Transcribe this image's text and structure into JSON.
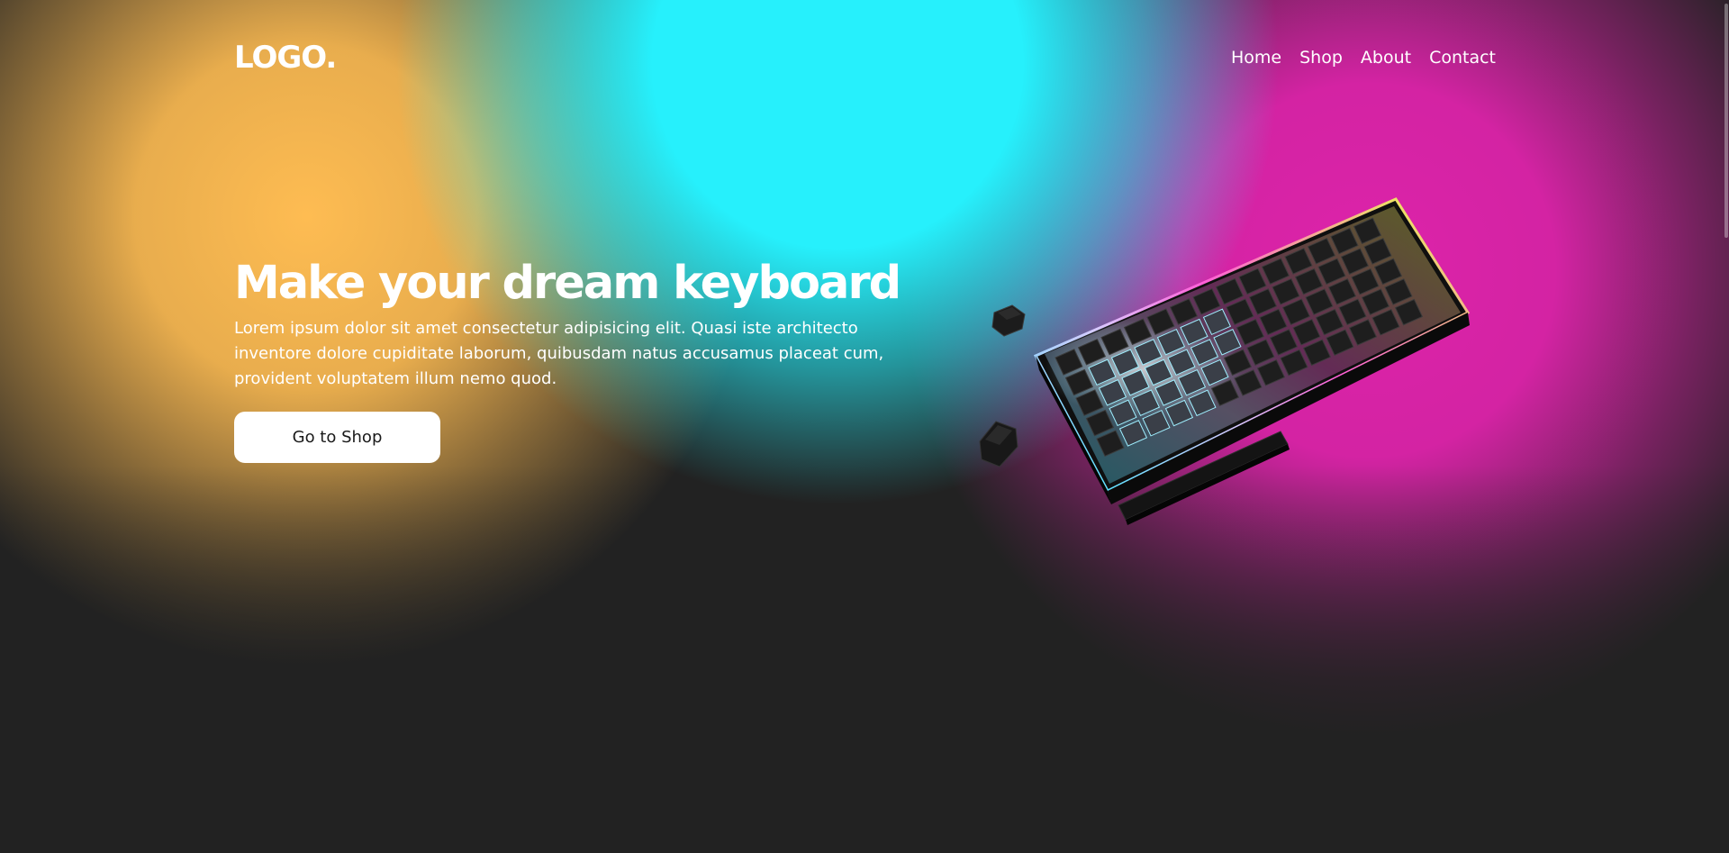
{
  "header": {
    "logo": "LOGO.",
    "nav": [
      {
        "label": "Home"
      },
      {
        "label": "Shop"
      },
      {
        "label": "About"
      },
      {
        "label": "Contact"
      }
    ]
  },
  "hero": {
    "title": "Make your dream keyboard",
    "description": "Lorem ipsum dolor sit amet consectetur adipisicing elit. Quasi iste architecto inventore dolore cupiditate laborum, quibusdam natus accusamus placeat cum, provident voluptatem illum nemo quod.",
    "cta_label": "Go to Shop"
  },
  "colors": {
    "background": "#222222",
    "yellow_glow": "#febc52",
    "cyan_glow": "#26f0fc",
    "magenta_glow": "#dd23aa",
    "button_bg": "#ffffff"
  }
}
